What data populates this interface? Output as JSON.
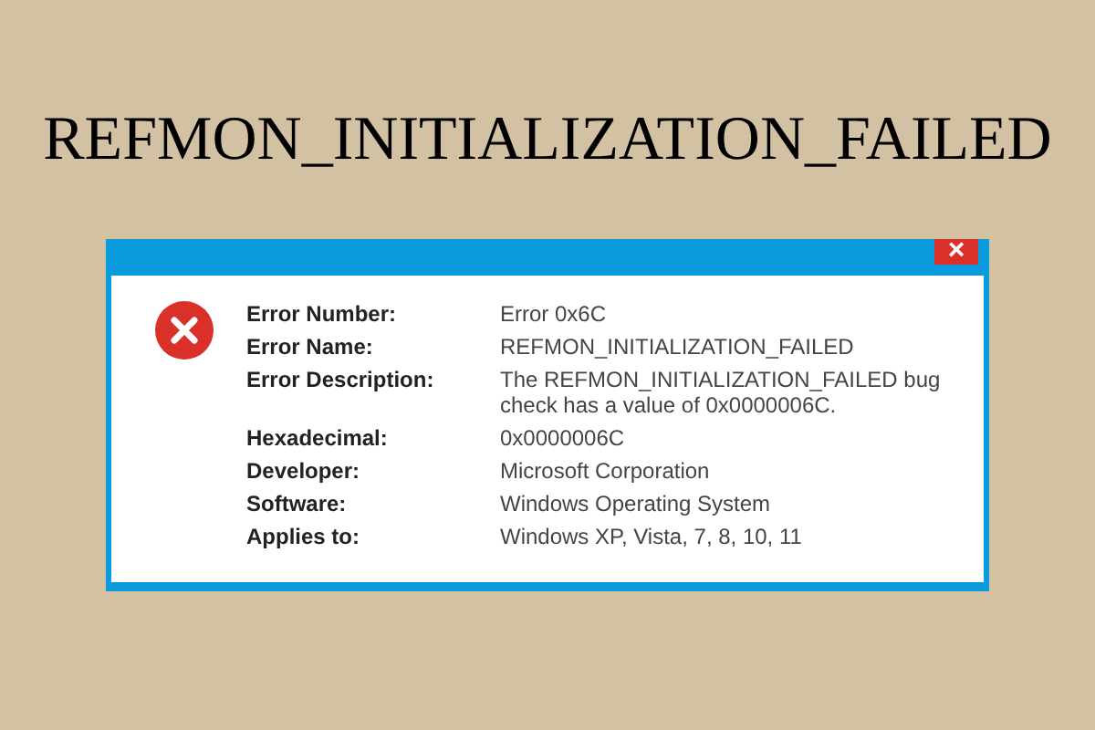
{
  "headline": "REFMON_INITIALIZATION_FAILED",
  "dialog": {
    "close": "×",
    "rows": [
      {
        "label": "Error Number:",
        "value": "Error 0x6C"
      },
      {
        "label": "Error Name:",
        "value": "REFMON_INITIALIZATION_FAILED"
      },
      {
        "label": "Error Description:",
        "value": "The REFMON_INITIALIZATION_FAILED bug check has a value of 0x0000006C."
      },
      {
        "label": "Hexadecimal:",
        "value": "0x0000006C"
      },
      {
        "label": "Developer:",
        "value": "Microsoft Corporation"
      },
      {
        "label": "Software:",
        "value": "Windows Operating System"
      },
      {
        "label": "Applies to:",
        "value": "Windows XP, Vista, 7, 8, 10, 11"
      }
    ]
  }
}
